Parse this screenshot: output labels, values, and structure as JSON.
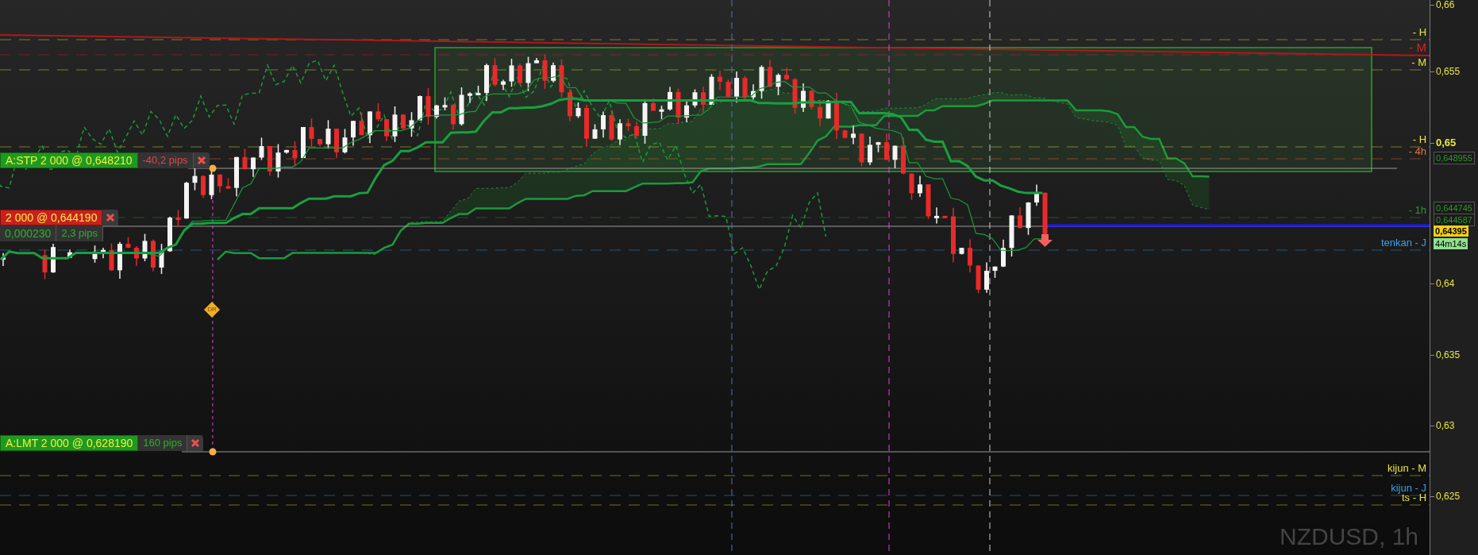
{
  "chart": {
    "symbol": "NZDUSD, 1h",
    "price_axis": [
      {
        "label": "0,66",
        "bold": false
      },
      {
        "label": "0,655",
        "bold": false
      },
      {
        "label": "0,65",
        "bold": true
      },
      {
        "label": "0,64",
        "bold": false
      },
      {
        "label": "0,635",
        "bold": false
      },
      {
        "label": "0,63",
        "bold": false
      },
      {
        "label": "0,625",
        "bold": false
      }
    ],
    "level_tags": [
      {
        "text": "- H",
        "color": "#e8e83a"
      },
      {
        "text": "- M",
        "color": "#e02020"
      },
      {
        "text": "- M",
        "color": "#e8e83a"
      },
      {
        "text": "- H",
        "color": "#e8e83a"
      },
      {
        "text": "- 4h",
        "color": "#e07838"
      },
      {
        "text": "- 1h",
        "color": "#2a9a2a"
      },
      {
        "text": "tenkan - J",
        "color": "#3aa0e8"
      },
      {
        "text": "kijun - M",
        "color": "#e8e83a"
      },
      {
        "text": "kijun - J",
        "color": "#3aa0e8"
      },
      {
        "text": "ts - H",
        "color": "#e8e83a"
      }
    ],
    "axis_tags": [
      {
        "text": "0,648955",
        "kind": "line"
      },
      {
        "text": "0,644745",
        "kind": "line"
      },
      {
        "text": "0,644587",
        "kind": "line"
      },
      {
        "text": "0,64395",
        "kind": "price"
      },
      {
        "text": "44m14s",
        "kind": "timer"
      }
    ],
    "orders": [
      {
        "kind": "order",
        "label": "A:STP 2 000 @ 0,648210",
        "pips": "-40,2 pips",
        "loss": true
      },
      {
        "kind": "position",
        "label": "2 000 @ 0,644190",
        "value": "0,000230",
        "pips": "2,3 pips",
        "loss": false
      },
      {
        "kind": "order",
        "label": "A:LMT 2 000 @ 0,628190",
        "pips": "160 pips",
        "loss": false
      }
    ],
    "marker": "DR"
  }
}
